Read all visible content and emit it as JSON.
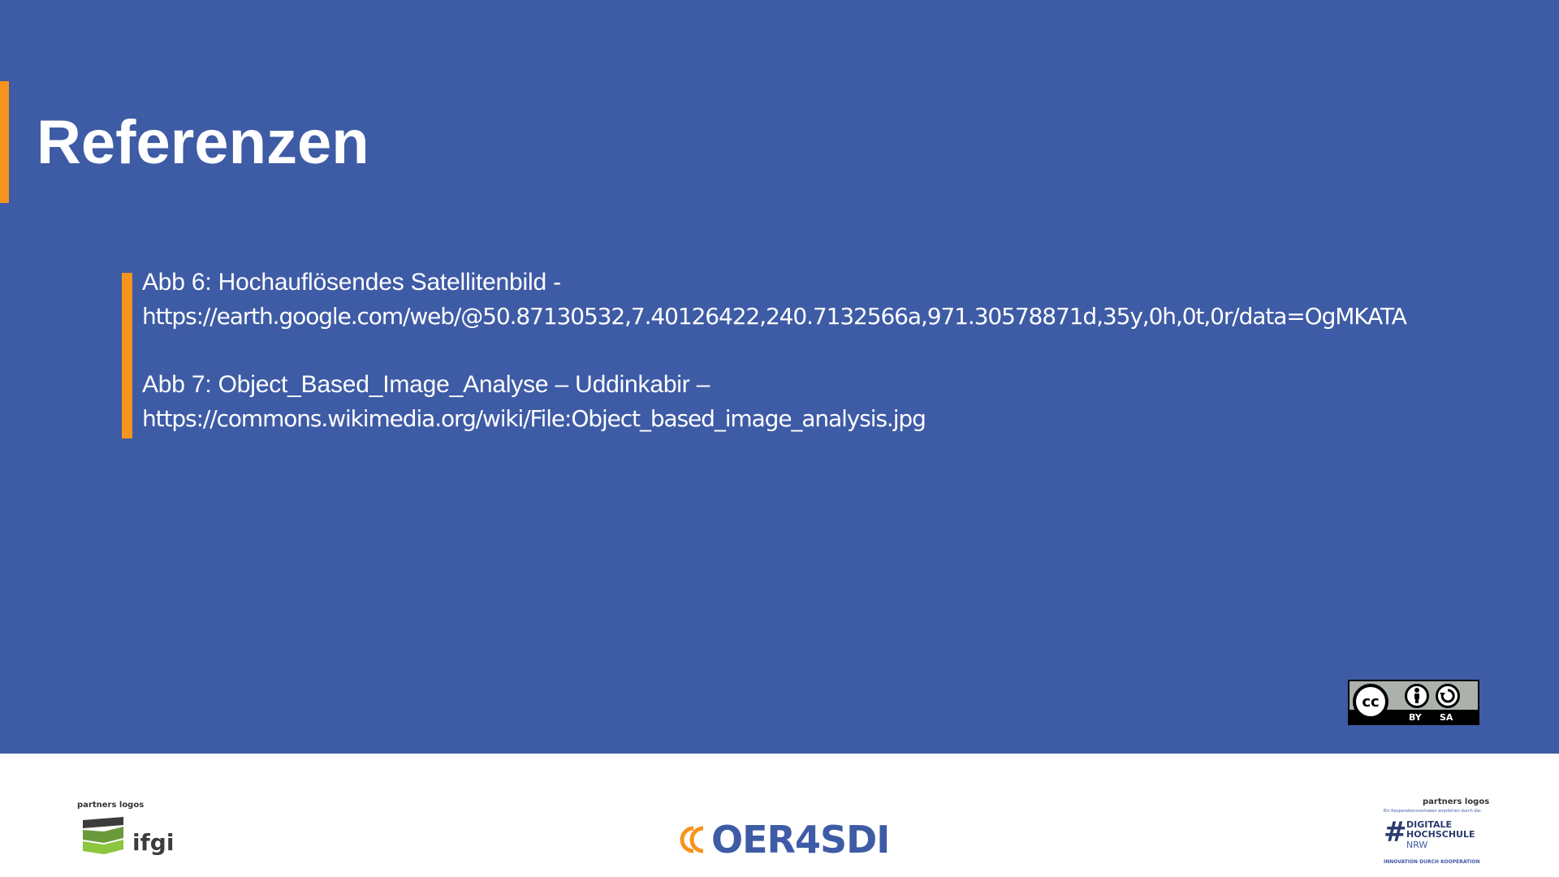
{
  "slide": {
    "title": "Referenzen",
    "references": [
      {
        "caption": "Abb 6: Hochauflösendes Satellitenbild -",
        "url": "https://earth.google.com/web/@50.87130532,7.40126422,240.7132566a,971.30578871d,35y,0h,0t,0r/data=OgMKATA"
      },
      {
        "caption": "Abb 7: Object_Based_Image_Analyse – Uddinkabir –",
        "url": "https://commons.wikimedia.org/wiki/File:Object_based_image_analysis.jpg"
      }
    ]
  },
  "license": {
    "cc": "cc",
    "by": "BY",
    "sa": "SA"
  },
  "footer": {
    "partners_label_left": "partners logos",
    "ifgi": "ifgi",
    "oer_logo": "OER4SDI",
    "partners_label_right": "partners logos",
    "dh_tiny": "Ein Kooperationsvorhaben empfohlen durch die:",
    "dh_name_line1": "DIGITALE",
    "dh_name_line2": "HOCHSCHULE",
    "dh_nrw": "NRW",
    "dh_tagline": "INNOVATION DURCH KOOPERATION"
  },
  "colors": {
    "background": "#3e5ba5",
    "accent": "#f7941d",
    "text": "#ffffff"
  },
  "icons": [
    "creative-commons-icon",
    "attribution-icon",
    "share-alike-icon",
    "ifgi-logo-icon",
    "oer4sdi-logo-icon",
    "digitale-hochschule-logo-icon"
  ]
}
